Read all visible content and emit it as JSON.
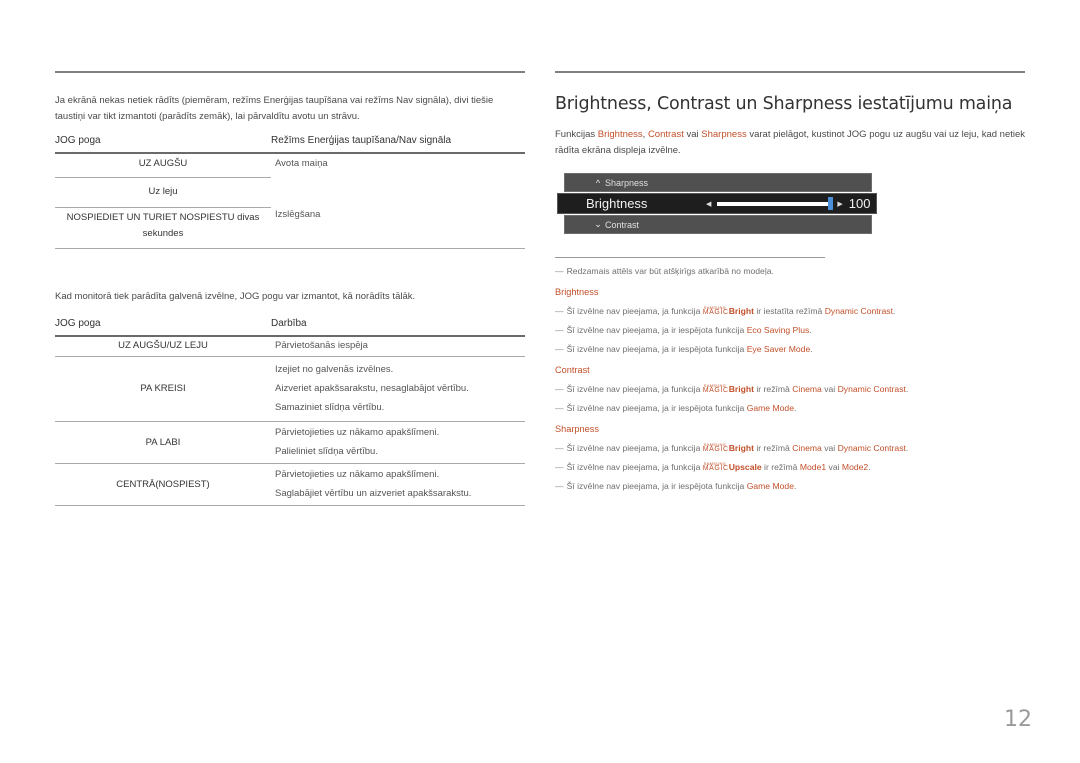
{
  "left": {
    "intro": "Ja ekrānā nekas netiek rādīts (piemēram, režīms Enerģijas taupīšana vai režīms Nav signāla), divi tiešie taustiņi var tikt izmantoti (parādīts zemāk), lai pārvaldītu avotu un strāvu.",
    "table1": {
      "headers": [
        "JOG poga",
        "Režīms Enerģijas taupīšana/Nav signāla"
      ],
      "rows": [
        {
          "button": "UZ AUGŠU",
          "action": "Avota maiņa"
        },
        {
          "button": "Uz leju",
          "action": ""
        },
        {
          "button": "NOSPIEDIET UN TURIET NOSPIESTU divas sekundes",
          "action": "Izslēgšana"
        }
      ]
    },
    "intro2": "Kad monitorā tiek parādīta galvenā izvēlne, JOG pogu var izmantot, kā norādīts tālāk.",
    "table2": {
      "headers": [
        "JOG poga",
        "Darbība"
      ],
      "rows": [
        {
          "button": "UZ AUGŠU/UZ LEJU",
          "actions": [
            "Pārvietošanās iespēja"
          ]
        },
        {
          "button": "PA KREISI",
          "actions": [
            "Izejiet no galvenās izvēlnes.",
            "Aizveriet apakšsarakstu, nesaglabājot vērtību.",
            "Samaziniet slīdņa vērtību."
          ]
        },
        {
          "button": "PA LABI",
          "actions": [
            "Pārvietojieties uz nākamo apakšlīmeni.",
            "Palieliniet slīdņa vērtību."
          ]
        },
        {
          "button": "CENTRĀ(NOSPIEST)",
          "actions": [
            "Pārvietojieties uz nākamo apakšlīmeni.",
            "Saglabājiet vērtību un aizveriet apakšsarakstu."
          ]
        }
      ]
    }
  },
  "right": {
    "title": "Brightness, Contrast un Sharpness iestatījumu maiņa",
    "para": {
      "p1": "Funkcijas ",
      "h1": "Brightness",
      "p2": ", ",
      "h2": "Contrast",
      "p3": " vai ",
      "h3": "Sharpness",
      "p4": " varat pielāgot, kustinot JOG pogu uz augšu vai uz leju, kad netiek rādīta ekrāna displeja izvēlne."
    },
    "osd": {
      "prev_item": "Sharpness",
      "current_item": "Brightness",
      "next_item": "Contrast",
      "value": "100",
      "slider_fraction": 1.0,
      "slider_color": "#4a8fd8"
    },
    "model_note": "Redzamais attēls var būt atšķirīgs atkarībā no modeļa.",
    "magic_top": "SAMSUNG",
    "magic_bottom": "MAGIC",
    "sections": [
      {
        "heading": "Brightness",
        "notes": [
          {
            "a": "Šī izvēlne nav pieejama, ja funkcija ",
            "magic": "Bright",
            "b": " ir iestatīta režīmā ",
            "h1": "Dynamic Contrast",
            "c": ".",
            "h2": "",
            "d": ""
          },
          {
            "a": "Šī izvēlne nav pieejama, ja ir iespējota funkcija ",
            "magic": "",
            "b": "",
            "h1": "Eco Saving Plus",
            "c": ".",
            "h2": "",
            "d": ""
          },
          {
            "a": "Šī izvēlne nav pieejama, ja ir iespējota funkcija ",
            "magic": "",
            "b": "",
            "h1": "Eye Saver Mode",
            "c": ".",
            "h2": "",
            "d": ""
          }
        ]
      },
      {
        "heading": "Contrast",
        "notes": [
          {
            "a": "Šī izvēlne nav pieejama, ja funkcija ",
            "magic": "Bright",
            "b": " ir režīmā ",
            "h1": "Cinema",
            "c": " vai ",
            "h2": "Dynamic Contrast",
            "d": "."
          },
          {
            "a": "Šī izvēlne nav pieejama, ja ir iespējota funkcija ",
            "magic": "",
            "b": "",
            "h1": "Game Mode",
            "c": ".",
            "h2": "",
            "d": ""
          }
        ]
      },
      {
        "heading": "Sharpness",
        "notes": [
          {
            "a": "Šī izvēlne nav pieejama, ja funkcija ",
            "magic": "Bright",
            "b": " ir režīmā ",
            "h1": "Cinema",
            "c": " vai ",
            "h2": "Dynamic Contrast",
            "d": "."
          },
          {
            "a": "Šī izvēlne nav pieejama, ja funkcija ",
            "magic": "Upscale",
            "b": " ir režīmā ",
            "h1": "Mode1",
            "c": " vai ",
            "h2": "Mode2",
            "d": "."
          },
          {
            "a": "Šī izvēlne nav pieejama, ja ir iespējota funkcija ",
            "magic": "",
            "b": "",
            "h1": "Game Mode",
            "c": ".",
            "h2": "",
            "d": ""
          }
        ]
      }
    ]
  },
  "page_number": "12",
  "colors": {
    "accent": "#c2502a",
    "text": "#4a4a4a",
    "rule": "#808080"
  }
}
